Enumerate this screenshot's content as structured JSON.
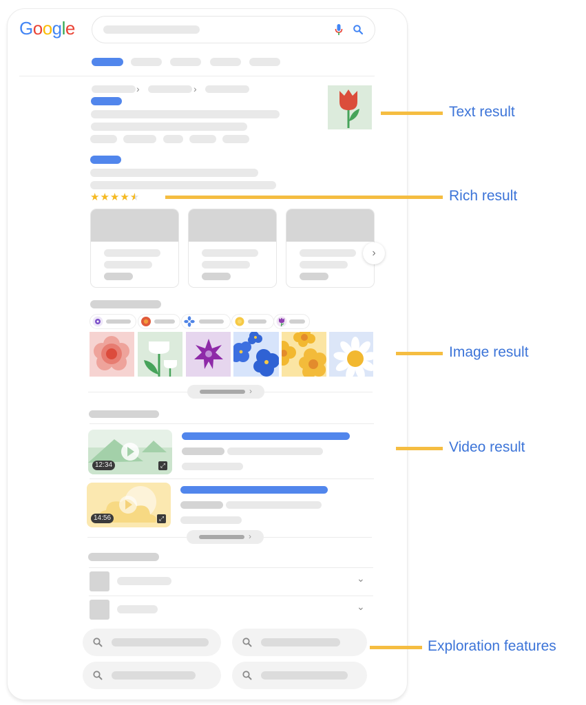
{
  "logo": {
    "letters": [
      "G",
      "o",
      "o",
      "g",
      "l",
      "e"
    ],
    "colors": [
      "#4285f4",
      "#ea4335",
      "#fbbc05",
      "#4285f4",
      "#34a853",
      "#ea4335"
    ]
  },
  "search": {
    "mic_icon": "mic-icon",
    "search_icon": "search-icon"
  },
  "tabs": {
    "count": 5,
    "active_index": 0
  },
  "text_result": {
    "thumbnail": "tulip-image",
    "breadcrumb_separators": [
      "›",
      "›"
    ]
  },
  "rich_result": {
    "rating": 4.5,
    "rating_max": 5,
    "stars": "★★★★",
    "half_star": "★",
    "cards": 3,
    "next_arrow": "›"
  },
  "image_result": {
    "chips": [
      {
        "icon": "purple-flower-icon",
        "color": "#7b4fc9"
      },
      {
        "icon": "red-flower-icon",
        "color": "#e05a3a"
      },
      {
        "icon": "blue-flower-icon",
        "color": "#4f84e6"
      },
      {
        "icon": "yellow-flower-icon",
        "color": "#f6c945"
      },
      {
        "icon": "purple-tulip-icon",
        "color": "#8e3fb0"
      }
    ],
    "images": [
      "red-rose-image",
      "white-tulips-image",
      "purple-flower-image",
      "blue-pansies-image",
      "yellow-flowers-image",
      "daisy-image"
    ],
    "more_arrow": "›"
  },
  "video_result": {
    "videos": [
      {
        "duration": "12:34",
        "thumbnail": "mountain-video-thumbnail"
      },
      {
        "duration": "14:56",
        "thumbnail": "sun-cloud-video-thumbnail"
      }
    ],
    "more_arrow": "›",
    "expand_glyph": "⤢"
  },
  "faq": {
    "items": 2,
    "chevron": "⌄"
  },
  "related_searches": {
    "items": 4
  },
  "annotations": [
    {
      "label": "Text result",
      "color": "#3c74d8"
    },
    {
      "label": "Rich result",
      "color": "#3c74d8"
    },
    {
      "label": "Image result",
      "color": "#3c74d8"
    },
    {
      "label": "Video result",
      "color": "#3c74d8"
    },
    {
      "label": "Exploration features",
      "color": "#3c74d8"
    }
  ],
  "annotation_line_color": "#f5bd41"
}
